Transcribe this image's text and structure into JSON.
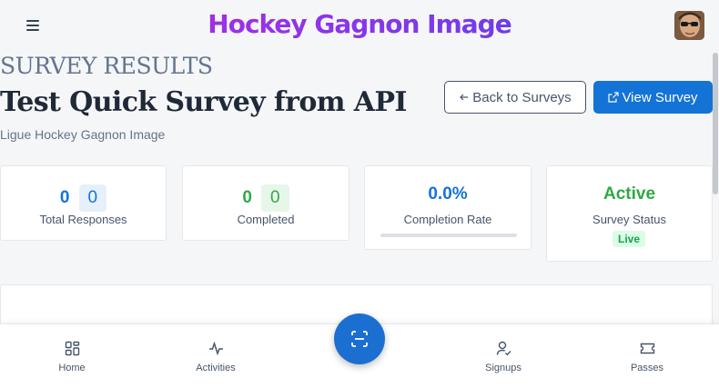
{
  "header": {
    "app_title": "Hockey Gagnon Image",
    "menu_icon": "hamburger-menu-icon",
    "avatar_icon": "user-avatar"
  },
  "survey": {
    "eyebrow": "SURVEY RESULTS",
    "title": "Test Quick Survey from API",
    "organization": "Ligue Hockey Gagnon Image"
  },
  "actions": {
    "back_label": "Back to Surveys",
    "back_icon": "arrow-left-icon",
    "view_label": "View Survey",
    "view_icon": "external-link-icon"
  },
  "stats": {
    "total_responses": {
      "value": "0",
      "badge": "0",
      "label": "Total Responses"
    },
    "completed": {
      "value": "0",
      "badge": "0",
      "label": "Completed"
    },
    "completion_rate": {
      "value": "0.0%",
      "label": "Completion Rate",
      "progress": 0
    },
    "status": {
      "value": "Active",
      "label": "Survey Status",
      "badge": "Live"
    }
  },
  "colors": {
    "primary": "#1473d6",
    "success": "#2faa44",
    "muted": "#64748b"
  },
  "bottom_nav": {
    "items": [
      {
        "label": "Home",
        "icon": "grid-icon"
      },
      {
        "label": "Activities",
        "icon": "activity-icon"
      },
      {
        "label": "Signups",
        "icon": "user-check-icon"
      },
      {
        "label": "Passes",
        "icon": "ticket-icon"
      }
    ],
    "scan_icon": "scan-icon"
  }
}
